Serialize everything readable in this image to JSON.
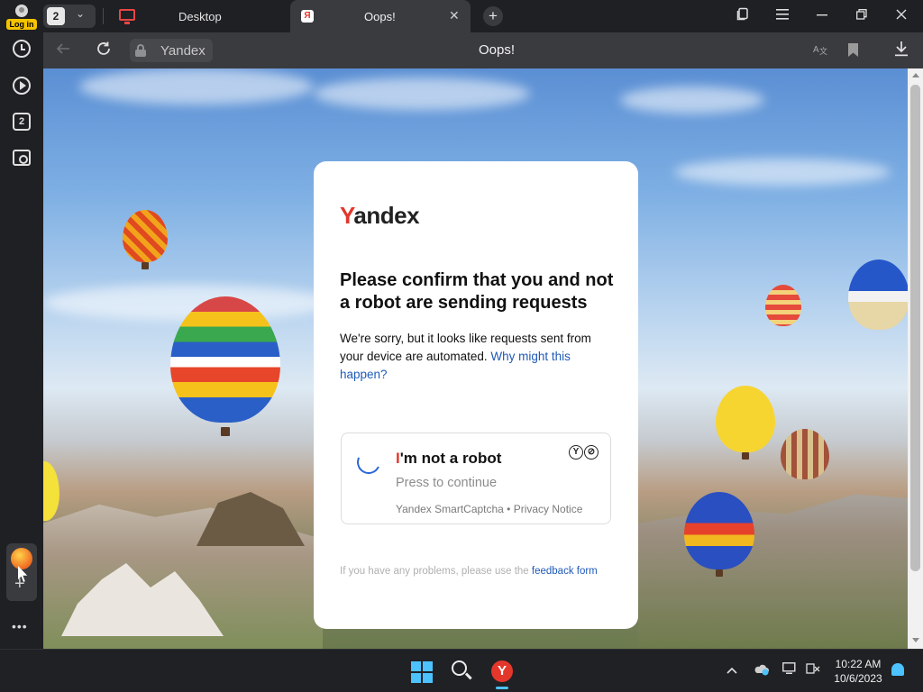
{
  "titlebar": {
    "login_label": "Log in",
    "tab_count": "2",
    "tabs": [
      {
        "label": "Desktop",
        "icon": "monitor-icon"
      },
      {
        "label": "Oops!",
        "icon": "yandex-favicon",
        "favicon_letter": "Я",
        "active": true
      }
    ],
    "close_tab_symbol": "✕",
    "new_tab_symbol": "+",
    "icons": [
      "tab-collections-icon",
      "menu-icon",
      "minimize-icon",
      "restore-icon",
      "close-window-icon"
    ]
  },
  "addressbar": {
    "domain": "Yandex",
    "page_title": "Oops!",
    "icons": [
      "back-icon",
      "reload-icon",
      "lock-icon",
      "translate-icon",
      "bookmark-icon",
      "download-icon"
    ]
  },
  "sidebar": {
    "tabs_badge": "2",
    "more_label": "•••",
    "icons": [
      "history-icon",
      "media-player-icon",
      "tabs-icon",
      "screenshot-icon",
      "alice-icon",
      "add-panel-icon"
    ]
  },
  "captcha": {
    "logo_first": "Y",
    "logo_rest": "andex",
    "heading": "Please confirm that you and not a robot are sending requests",
    "body": "We're sorry, but it looks like requests sent from your device are automated.",
    "link": "Why might this happen?",
    "check_first": "I",
    "check_rest": "'m not a robot",
    "check_hint": "Press to continue",
    "check_footer": "Yandex SmartCaptcha • Privacy Notice",
    "badge_letters": [
      "Y",
      "⊘"
    ],
    "problem_text": "If you have any problems, please use the",
    "problem_link": "feedback form"
  },
  "taskbar": {
    "time": "10:22 AM",
    "date": "10/6/2023",
    "browser_letter": "Y",
    "icons": [
      "windows-start-icon",
      "search-icon",
      "yandex-browser-icon",
      "chevron-up-icon",
      "onedrive-icon",
      "display-icon",
      "network-icon",
      "notification-bell-icon"
    ]
  },
  "colors": {
    "accent_red": "#e3372c",
    "link_blue": "#1f5ab8",
    "login_yellow": "#f5c400",
    "taskbar_blue": "#4cc2ff"
  }
}
